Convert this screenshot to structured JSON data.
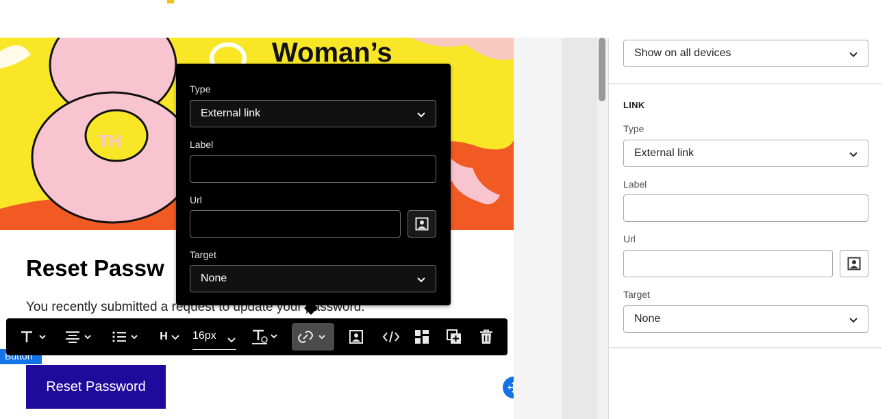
{
  "email": {
    "hero_title": "Woman’s",
    "heading": "Reset Passw",
    "body_text": "You recently submitted a request to update your password.",
    "button_tag": "Button",
    "cta_label": "Reset Password"
  },
  "link_popover": {
    "type_label": "Type",
    "type_value": "External link",
    "label_label": "Label",
    "label_value": "",
    "url_label": "Url",
    "url_value": "",
    "target_label": "Target",
    "target_value": "None"
  },
  "toolbar": {
    "font_size": "16px",
    "heading_label": "H",
    "icons": [
      "text-style-icon",
      "align-icon",
      "list-icon",
      "heading-icon",
      "font-size-dropdown",
      "text-color-icon",
      "link-icon",
      "image-icon",
      "code-icon",
      "layout-icon",
      "duplicate-icon",
      "trash-icon"
    ]
  },
  "panel": {
    "visibility_value": "Show on all devices",
    "section_link": "LINK",
    "type_label": "Type",
    "type_value": "External link",
    "label_label": "Label",
    "label_value": "",
    "url_label": "Url",
    "url_value": "",
    "target_label": "Target",
    "target_value": "None"
  },
  "colors": {
    "hero_yellow": "#f9e727",
    "cta_blue": "#1e0b9b",
    "accent_blue": "#1473e6"
  }
}
